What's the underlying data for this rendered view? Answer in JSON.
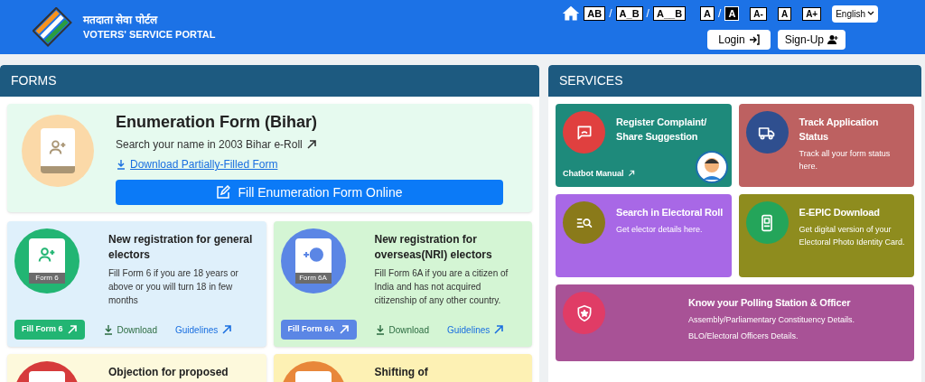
{
  "header": {
    "title_hindi": "मतदाता सेवा पोर्टल",
    "title_english": "VOTERS' SERVICE PORTAL",
    "spacing_options": [
      {
        "label": "AB",
        "selected": false
      },
      {
        "separator": "/",
        "label": "A_B",
        "selected": false
      },
      {
        "separator": "/",
        "label": "A__B",
        "selected": false
      }
    ],
    "contrast_options": [
      {
        "label": "A",
        "selected": false
      },
      {
        "separator": "/",
        "label": "A",
        "selected": true
      }
    ],
    "size_options": [
      "A-",
      "A",
      "A+"
    ],
    "language": "English",
    "login": "Login",
    "signup": "Sign-Up"
  },
  "forms": {
    "title": "FORMS",
    "featured": {
      "title": "Enumeration Form (Bihar)",
      "search_link": "Search your name in 2003 Bihar e-Roll",
      "download_link": "Download Partially-Filled Form",
      "button": "Fill Enumeration Form Online"
    },
    "cards": [
      {
        "title": "New registration for general electors",
        "description": "Fill Form 6 if you are 18 years or above or you will turn 18 in few months",
        "badge": "Form 6",
        "fill_button": "Fill Form 6",
        "download": "Download",
        "guidelines": "Guidelines",
        "color": "#dff0fb",
        "kind": "person"
      },
      {
        "title": "New registration for overseas(NRI) electors",
        "description": "Fill Form 6A if you are a citizen of India and has not acquired citizenship of any other country.",
        "badge": "Form 6A",
        "fill_button": "Fill Form 6A",
        "download": "Download",
        "guidelines": "Guidelines",
        "color": "#d4f5d4",
        "kind": "globe"
      },
      {
        "title": "Objection for proposed",
        "color": "#fdf9dc",
        "kind": "objection"
      },
      {
        "title": "Shifting of",
        "color": "#fdf1b4",
        "kind": "shifting"
      }
    ]
  },
  "services": {
    "title": "SERVICES",
    "cards": [
      {
        "title": "Register Complaint/ Share Suggestion",
        "link": "Chatbot Manual",
        "color": "#1e8a7b",
        "kind": "chat",
        "wide": false
      },
      {
        "title": "Track Application Status",
        "lines": [
          "Track all your form status here."
        ],
        "color": "#bd6161",
        "kind": "truck",
        "wide": false
      },
      {
        "title": "Search in Electoral Roll",
        "lines": [
          "Get elector details here."
        ],
        "color": "#a868e6",
        "kind": "search",
        "wide": false
      },
      {
        "title": "E-EPIC Download",
        "lines": [
          "Get digital version of your Electoral Photo Identity Card."
        ],
        "color": "#8e8c1e",
        "kind": "card",
        "wide": false
      },
      {
        "title": "Know your Polling Station & Officer",
        "lines": [
          "Assembly/Parliamentary Constituency Details.",
          "BLO/Electoral Officers Details."
        ],
        "color": "#a85296",
        "kind": "shield",
        "wide": true
      }
    ]
  }
}
